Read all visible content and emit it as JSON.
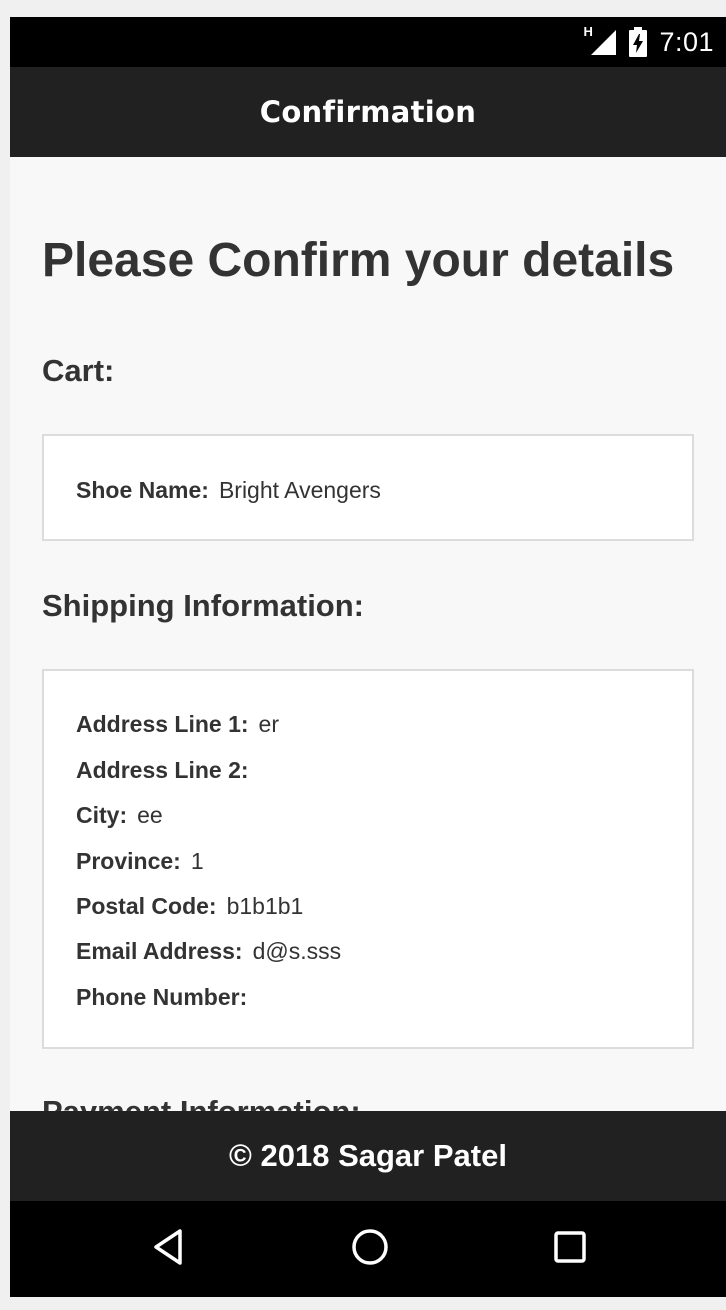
{
  "status_bar": {
    "network_label": "H",
    "time": "7:01"
  },
  "app_bar": {
    "title": "Confirmation"
  },
  "page": {
    "title": "Please Confirm your details"
  },
  "cart": {
    "heading": "Cart:",
    "fields": [
      {
        "label": "Shoe Name:",
        "value": "Bright Avengers"
      }
    ]
  },
  "shipping": {
    "heading": "Shipping Information:",
    "fields": [
      {
        "label": "Address Line 1:",
        "value": "er"
      },
      {
        "label": "Address Line 2:",
        "value": ""
      },
      {
        "label": "City:",
        "value": "ee"
      },
      {
        "label": "Province:",
        "value": "1"
      },
      {
        "label": "Postal Code:",
        "value": "b1b1b1"
      },
      {
        "label": "Email Address:",
        "value": "d@s.sss"
      },
      {
        "label": "Phone Number:",
        "value": ""
      }
    ]
  },
  "payment": {
    "heading": "Payment Information:"
  },
  "footer": {
    "text": "© 2018 Sagar Patel"
  },
  "nav_bar": {
    "buttons": [
      "back-icon",
      "home-icon",
      "recents-icon"
    ]
  },
  "colors": {
    "bar_dark": "#212121",
    "system_black": "#000000",
    "page_bg": "#f8f8f8",
    "text": "#333333",
    "card_border": "#dcdcdc"
  }
}
